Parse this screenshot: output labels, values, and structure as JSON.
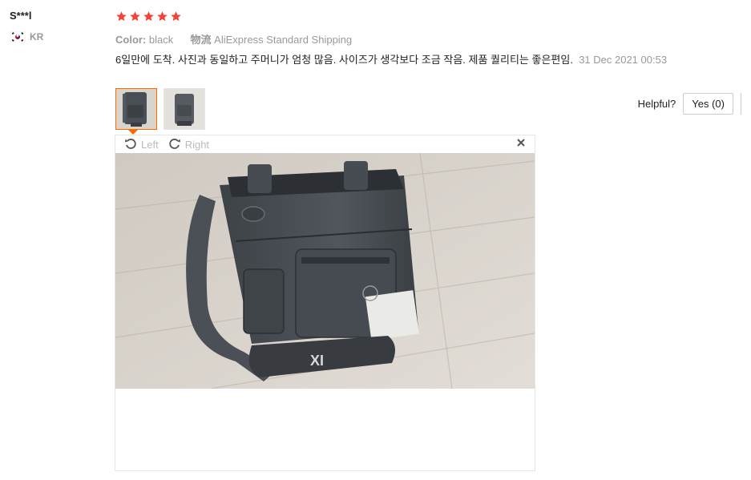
{
  "user": {
    "name": "S***l",
    "country_code": "KR",
    "flag_icon": "south-korea-flag-icon"
  },
  "review": {
    "rating": 5,
    "rating_max": 5,
    "star_color": "#f44336",
    "color_label": "Color:",
    "color_value": "black",
    "shipping_label": "物流",
    "shipping_value": "AliExpress Standard Shipping",
    "text": "6일만에 도착. 사진과 동일하고 주머니가 엄청 많음. 사이즈가 생각보다 조금 작음. 제품 퀄리티는 좋은편임.",
    "date": "31 Dec 2021 00:53"
  },
  "thumbnails": [
    {
      "name": "review-photo-1",
      "active": true
    },
    {
      "name": "review-photo-2",
      "active": false
    }
  ],
  "helpful": {
    "label": "Helpful?",
    "yes_label": "Yes (0)"
  },
  "viewer": {
    "rotate_left_label": "Left",
    "rotate_right_label": "Right",
    "close_icon": "close-icon",
    "photo_subject": "gray messenger bag on wooden floor",
    "photo_logo_text": "XI"
  },
  "colors": {
    "accent": "#ff6a00",
    "muted_text": "#999999",
    "star": "#f44336"
  }
}
